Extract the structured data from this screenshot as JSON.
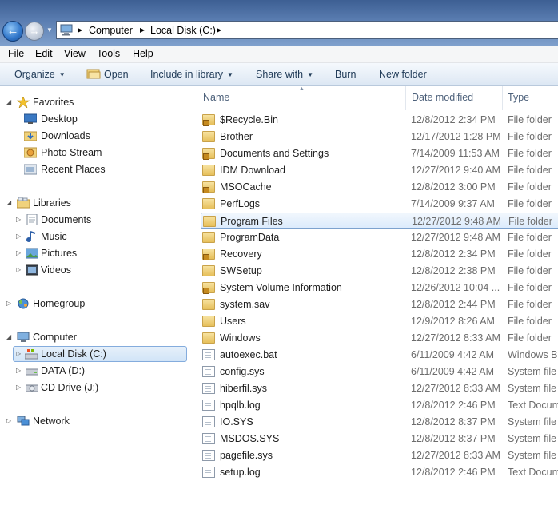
{
  "address_bar": {
    "crumbs": [
      "Computer",
      "Local Disk (C:)"
    ]
  },
  "menu": [
    "File",
    "Edit",
    "View",
    "Tools",
    "Help"
  ],
  "toolbar": {
    "organize": "Organize",
    "open": "Open",
    "include": "Include in library",
    "share": "Share with",
    "burn": "Burn",
    "new_folder": "New folder"
  },
  "nav": {
    "favorites": "Favorites",
    "desktop": "Desktop",
    "downloads": "Downloads",
    "photo_stream": "Photo Stream",
    "recent_places": "Recent Places",
    "libraries": "Libraries",
    "documents": "Documents",
    "music": "Music",
    "pictures": "Pictures",
    "videos": "Videos",
    "homegroup": "Homegroup",
    "computer": "Computer",
    "local_disk": "Local Disk (C:)",
    "data_drive": "DATA (D:)",
    "cd_drive": "CD Drive (J:)",
    "network": "Network"
  },
  "columns": {
    "name": "Name",
    "date": "Date modified",
    "type": "Type"
  },
  "files": [
    {
      "name": "$Recycle.Bin",
      "date": "12/8/2012 2:34 PM",
      "type": "File folder",
      "icon": "locked-folder-icon"
    },
    {
      "name": "Brother",
      "date": "12/17/2012 1:28 PM",
      "type": "File folder",
      "icon": "folder-icon"
    },
    {
      "name": "Documents and Settings",
      "date": "7/14/2009 11:53 AM",
      "type": "File folder",
      "icon": "locked-folder-icon"
    },
    {
      "name": "IDM Download",
      "date": "12/27/2012 9:40 AM",
      "type": "File folder",
      "icon": "folder-icon"
    },
    {
      "name": "MSOCache",
      "date": "12/8/2012 3:00 PM",
      "type": "File folder",
      "icon": "locked-folder-icon"
    },
    {
      "name": "PerfLogs",
      "date": "7/14/2009 9:37 AM",
      "type": "File folder",
      "icon": "folder-icon"
    },
    {
      "name": "Program Files",
      "date": "12/27/2012 9:48 AM",
      "type": "File folder",
      "icon": "folder-icon"
    },
    {
      "name": "ProgramData",
      "date": "12/27/2012 9:48 AM",
      "type": "File folder",
      "icon": "folder-icon"
    },
    {
      "name": "Recovery",
      "date": "12/8/2012 2:34 PM",
      "type": "File folder",
      "icon": "locked-folder-icon"
    },
    {
      "name": "SWSetup",
      "date": "12/8/2012 2:38 PM",
      "type": "File folder",
      "icon": "folder-icon"
    },
    {
      "name": "System Volume Information",
      "date": "12/26/2012 10:04 ...",
      "type": "File folder",
      "icon": "locked-folder-icon"
    },
    {
      "name": "system.sav",
      "date": "12/8/2012 2:44 PM",
      "type": "File folder",
      "icon": "folder-icon"
    },
    {
      "name": "Users",
      "date": "12/9/2012 8:26 AM",
      "type": "File folder",
      "icon": "folder-icon"
    },
    {
      "name": "Windows",
      "date": "12/27/2012 8:33 AM",
      "type": "File folder",
      "icon": "folder-icon"
    },
    {
      "name": "autoexec.bat",
      "date": "6/11/2009 4:42 AM",
      "type": "Windows Ba",
      "icon": "batch-file-icon"
    },
    {
      "name": "config.sys",
      "date": "6/11/2009 4:42 AM",
      "type": "System file",
      "icon": "system-file-icon"
    },
    {
      "name": "hiberfil.sys",
      "date": "12/27/2012 8:33 AM",
      "type": "System file",
      "icon": "system-file-icon"
    },
    {
      "name": "hpqlb.log",
      "date": "12/8/2012 2:46 PM",
      "type": "Text Docum",
      "icon": "text-file-icon"
    },
    {
      "name": "IO.SYS",
      "date": "12/8/2012 8:37 PM",
      "type": "System file",
      "icon": "system-file-icon"
    },
    {
      "name": "MSDOS.SYS",
      "date": "12/8/2012 8:37 PM",
      "type": "System file",
      "icon": "system-file-icon"
    },
    {
      "name": "pagefile.sys",
      "date": "12/27/2012 8:33 AM",
      "type": "System file",
      "icon": "system-file-icon"
    },
    {
      "name": "setup.log",
      "date": "12/8/2012 2:46 PM",
      "type": "Text Docum",
      "icon": "text-file-icon"
    }
  ],
  "selected_file": "Program Files",
  "colors": {
    "accent": "#3d5f93",
    "selection_border": "#7da2ce",
    "toolbar_text": "#1e3956"
  }
}
